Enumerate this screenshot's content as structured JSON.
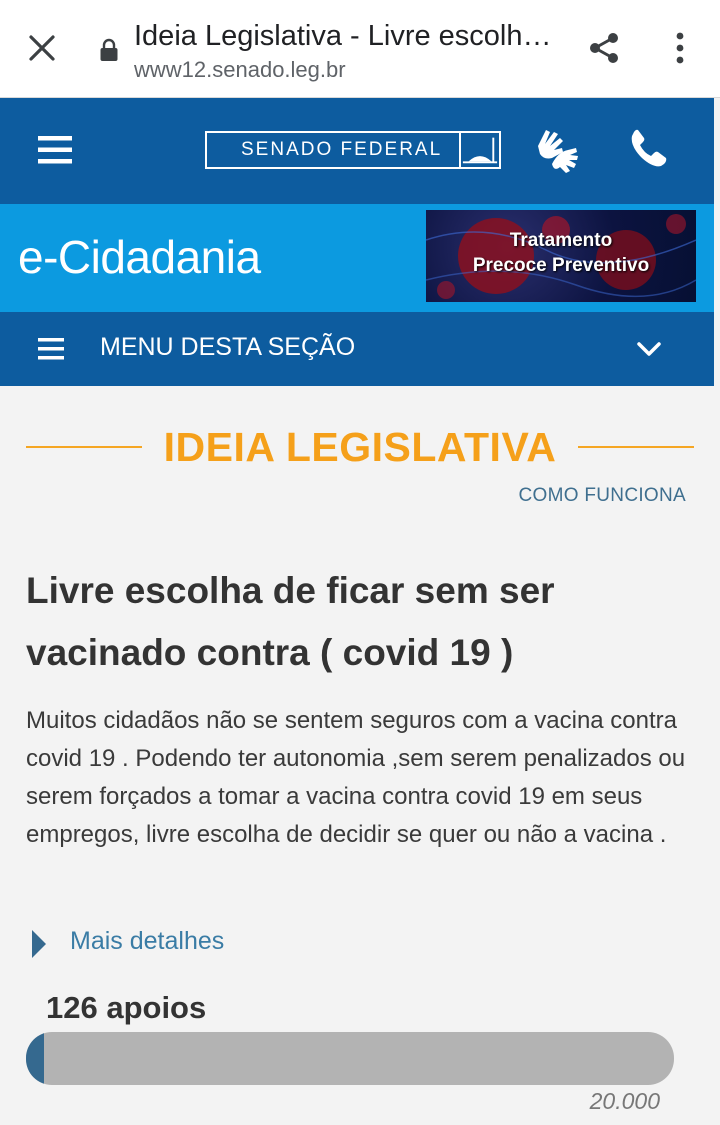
{
  "browser": {
    "page_title": "Ideia Legislativa - Livre escolha de ficar sem ser vacinado contra ( covid 19 )",
    "domain": "www12.senado.leg.br",
    "icons": [
      "close-icon",
      "lock-icon",
      "share-icon",
      "more-vert-icon"
    ]
  },
  "header": {
    "logo_text": "SENADO FEDERAL",
    "icons": [
      "menu-icon",
      "sign-language-icon",
      "phone-icon"
    ],
    "color": "#0d5c9f"
  },
  "ecidadania": {
    "logo": "e-Cidadania",
    "banner_line1": "Tratamento",
    "banner_line2": "Precoce Preventivo",
    "color": "#0c9ae0"
  },
  "section_menu": {
    "label": "MENU DESTA SEÇÃO"
  },
  "content": {
    "section_title": "IDEIA LEGISLATIVA",
    "how_it_works": "COMO FUNCIONA",
    "idea_title": "Livre escolha de ficar sem ser vacinado contra ( covid 19 )",
    "idea_description": "Muitos cidadãos não se sentem seguros com a vacina contra covid 19 . Podendo ter autonomia ,sem serem penalizados ou serem forçados a tomar a vacina contra covid 19 em seus empregos, livre escolha de decidir se quer ou não a vacina .",
    "details_link": "Mais detalhes",
    "supports_label": "126 apoios",
    "supports_count": 126,
    "goal_label": "20.000",
    "goal_count": 20000,
    "accent_color": "#f5a01a"
  }
}
